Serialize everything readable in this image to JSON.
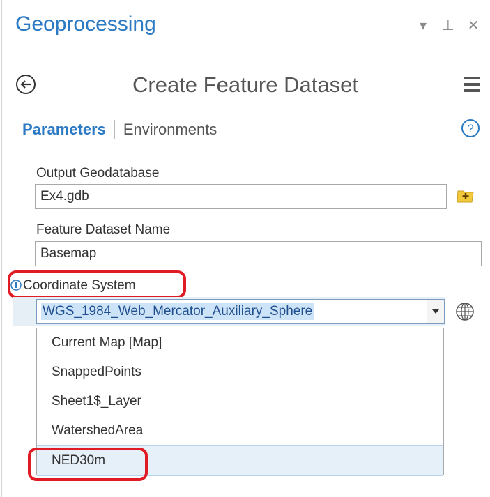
{
  "pane": {
    "title": "Geoprocessing",
    "controls": [
      "▾",
      "⊥",
      "✕"
    ]
  },
  "tool": {
    "title": "Create Feature Dataset",
    "back_icon": "back-arrow-icon",
    "menu_icon": "hamburger-menu-icon"
  },
  "tabs": {
    "parameters": "Parameters",
    "environments": "Environments",
    "help_icon": "help-icon"
  },
  "params": {
    "output_gdb_label": "Output Geodatabase",
    "output_gdb_value": "Ex4.gdb",
    "dataset_name_label": "Feature Dataset Name",
    "dataset_name_value": "Basemap",
    "coord_label": "Coordinate System",
    "coord_value": "WGS_1984_Web_Mercator_Auxiliary_Sphere"
  },
  "dropdown": {
    "items": [
      "Current Map [Map]",
      "SnappedPoints",
      "Sheet1$_Layer",
      "WatershedArea",
      "NED30m"
    ]
  },
  "colors": {
    "accent": "#2c7ac3",
    "highlight": "#e01b24"
  }
}
